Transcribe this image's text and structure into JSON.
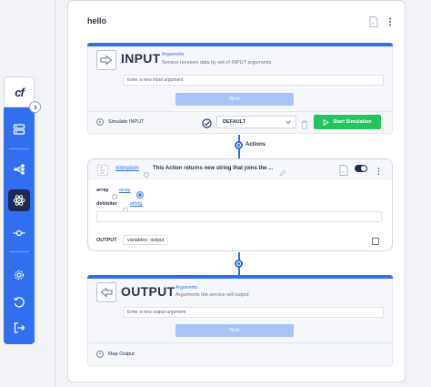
{
  "sidebar": {
    "logo_text": "cf",
    "items": [
      {
        "icon": "server-icon"
      },
      {
        "icon": "flow-icon"
      },
      {
        "icon": "atom-icon",
        "active": true
      },
      {
        "icon": "commit-icon"
      },
      {
        "icon": "gear-icon"
      },
      {
        "icon": "history-icon"
      },
      {
        "icon": "logout-icon"
      }
    ]
  },
  "flow": {
    "title": "hello",
    "input": {
      "label": "INPUT",
      "arguments_label": "Arguments",
      "description": "Service receives data by set of INPUT arguments",
      "placeholder": "Enter a new input argument",
      "next_label": "Next",
      "simulate_label": "Simulate INPUT",
      "dropdown_value": "DEFAULT",
      "start_label": "Start Simulation"
    },
    "actions_label": "Actions",
    "action": {
      "name": "string/join",
      "description": "This Action returns new string that joins the ...",
      "param1_label": "array",
      "param1_type": "array",
      "param2_label": "delimiter",
      "param2_type": "string",
      "output_label": "OUTPUT",
      "output_variable": "variables: output"
    },
    "output": {
      "label": "OUTPUT",
      "arguments_label": "Arguments",
      "description": "Arguments the service will output",
      "placeholder": "Enter a new output argument",
      "next_label": "Next",
      "map_label": "Map Output"
    }
  },
  "colors": {
    "accent": "#2f6ff0",
    "success": "#22c55e",
    "dark": "#1d2b55"
  }
}
